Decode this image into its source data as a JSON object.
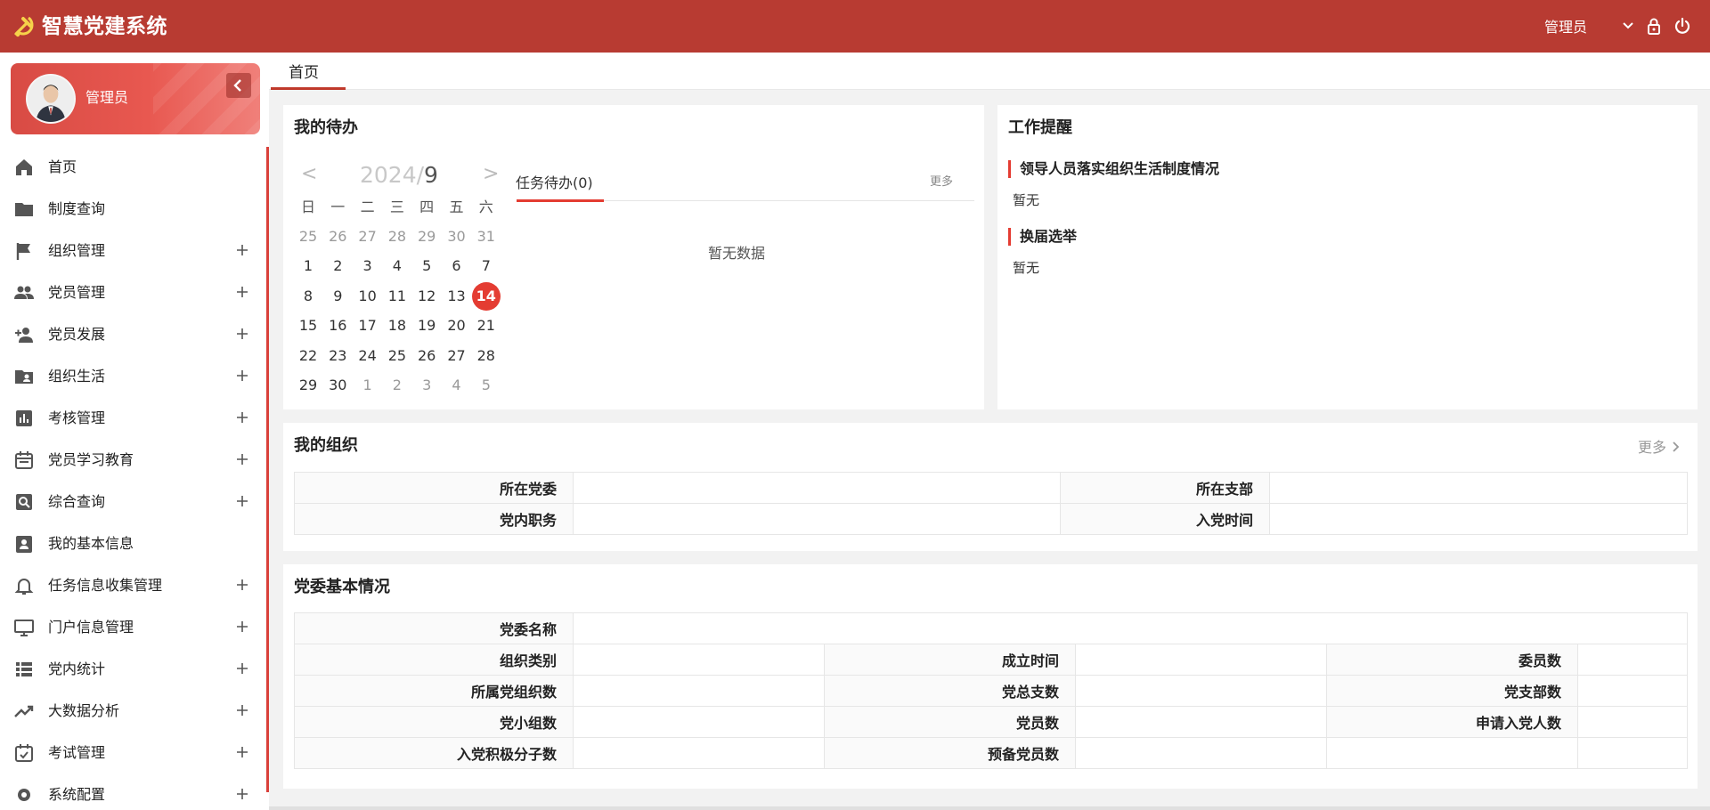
{
  "header": {
    "title": "智慧党建系统",
    "user": "管理员",
    "brand_color": "#b83b32"
  },
  "profile": {
    "name": "管理员"
  },
  "sidebar": {
    "items": [
      {
        "label": "首页",
        "icon": "home-icon",
        "expandable": false
      },
      {
        "label": "制度查询",
        "icon": "folder-icon",
        "expandable": false
      },
      {
        "label": "组织管理",
        "icon": "flag-icon",
        "expandable": true
      },
      {
        "label": "党员管理",
        "icon": "people-icon",
        "expandable": true
      },
      {
        "label": "党员发展",
        "icon": "person-add-icon",
        "expandable": true
      },
      {
        "label": "组织生活",
        "icon": "folder-user-icon",
        "expandable": true
      },
      {
        "label": "考核管理",
        "icon": "bar-chart-icon",
        "expandable": true
      },
      {
        "label": "党员学习教育",
        "icon": "calendar-icon",
        "expandable": true
      },
      {
        "label": "综合查询",
        "icon": "search-box-icon",
        "expandable": true
      },
      {
        "label": "我的基本信息",
        "icon": "contact-card-icon",
        "expandable": false
      },
      {
        "label": "任务信息收集管理",
        "icon": "bell-icon",
        "expandable": true
      },
      {
        "label": "门户信息管理",
        "icon": "monitor-icon",
        "expandable": true
      },
      {
        "label": "党内统计",
        "icon": "list-icon",
        "expandable": true
      },
      {
        "label": "大数据分析",
        "icon": "trend-icon",
        "expandable": true
      },
      {
        "label": "考试管理",
        "icon": "checkbox-calendar-icon",
        "expandable": true
      },
      {
        "label": "系统配置",
        "icon": "gear-icon",
        "expandable": true
      }
    ]
  },
  "tabs": [
    {
      "label": "首页",
      "active": true
    }
  ],
  "todo": {
    "title": "我的待办",
    "calendar": {
      "prev": "<",
      "next": ">",
      "year": "2024/",
      "month": "9",
      "weekdays": [
        "日",
        "一",
        "二",
        "三",
        "四",
        "五",
        "六"
      ],
      "weeks": [
        [
          "25",
          "26",
          "27",
          "28",
          "29",
          "30",
          "31"
        ],
        [
          "1",
          "2",
          "3",
          "4",
          "5",
          "6",
          "7"
        ],
        [
          "8",
          "9",
          "10",
          "11",
          "12",
          "13",
          "14"
        ],
        [
          "15",
          "16",
          "17",
          "18",
          "19",
          "20",
          "21"
        ],
        [
          "22",
          "23",
          "24",
          "25",
          "26",
          "27",
          "28"
        ],
        [
          "29",
          "30",
          "1",
          "2",
          "3",
          "4",
          "5"
        ]
      ],
      "today": "14"
    },
    "task_tab": "任务待办(0)",
    "more": "更多",
    "empty": "暂无数据"
  },
  "reminder": {
    "title": "工作提醒",
    "sections": [
      {
        "title": "领导人员落实组织生活制度情况",
        "value": "暂无"
      },
      {
        "title": "换届选举",
        "value": "暂无"
      }
    ]
  },
  "my_org": {
    "title": "我的组织",
    "more": "更多",
    "rows": [
      [
        {
          "k": "所在党委",
          "v": ""
        },
        {
          "k": "所在支部",
          "v": ""
        }
      ],
      [
        {
          "k": "党内职务",
          "v": ""
        },
        {
          "k": "入党时间",
          "v": ""
        }
      ]
    ]
  },
  "committee": {
    "title": "党委基本情况",
    "name_label": "党委名称",
    "name_value": "",
    "rows": [
      [
        {
          "k": "组织类别",
          "v": ""
        },
        {
          "k": "成立时间",
          "v": ""
        },
        {
          "k": "委员数",
          "v": ""
        }
      ],
      [
        {
          "k": "所属党组织数",
          "v": ""
        },
        {
          "k": "党总支数",
          "v": ""
        },
        {
          "k": "党支部数",
          "v": ""
        }
      ],
      [
        {
          "k": "党小组数",
          "v": ""
        },
        {
          "k": "党员数",
          "v": ""
        },
        {
          "k": "申请入党人数",
          "v": ""
        }
      ],
      [
        {
          "k": "入党积极分子数",
          "v": ""
        },
        {
          "k": "预备党员数",
          "v": ""
        }
      ]
    ]
  }
}
